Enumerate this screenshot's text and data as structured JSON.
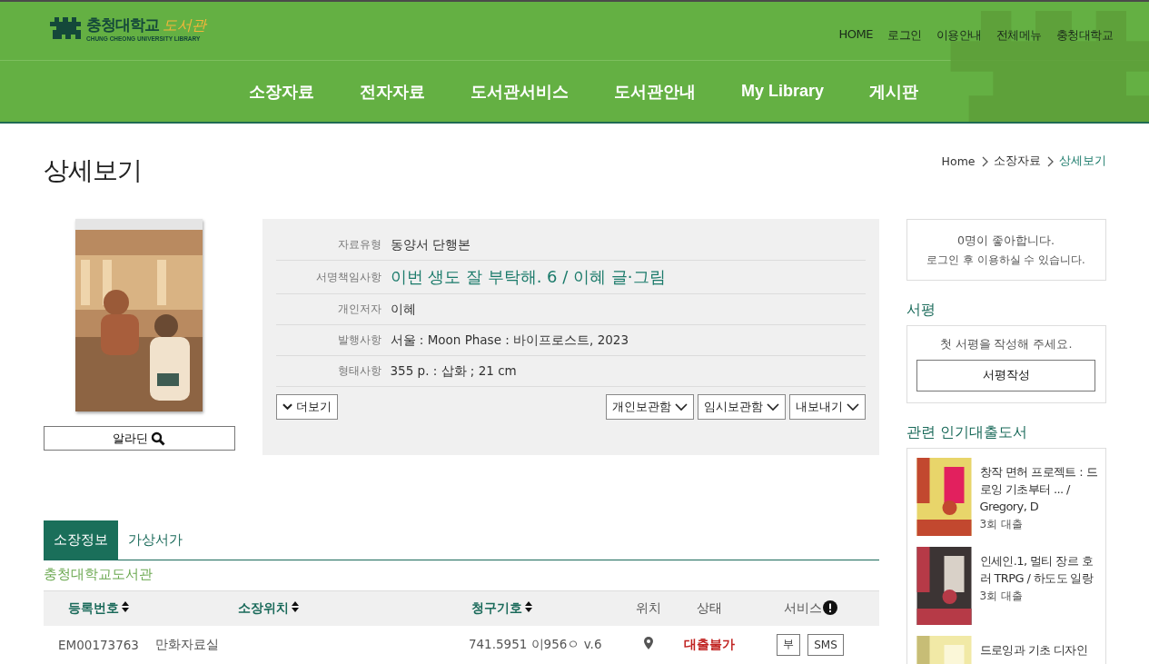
{
  "header": {
    "logo": {
      "name": "충청대학교",
      "library": "도서관",
      "subtitle": "CHUNG CHEONG UNIVERSITY LIBRARY"
    },
    "util_links": [
      "HOME",
      "로그인",
      "이용안내",
      "전체메뉴",
      "충청대학교"
    ],
    "nav": [
      "소장자료",
      "전자자료",
      "도서관서비스",
      "도서관안내",
      "My Library",
      "게시판"
    ]
  },
  "page_title": "상세보기",
  "breadcrumb": [
    {
      "label": "Home",
      "selected": false
    },
    {
      "label": "소장자료",
      "selected": false
    },
    {
      "label": "상세보기",
      "selected": true
    }
  ],
  "cover": {
    "link_label": "알라딘"
  },
  "details": [
    {
      "label": "자료유형",
      "value": "동양서 단행본",
      "kind": "plain"
    },
    {
      "label": "서명책임사항",
      "value": "이번 생도 잘 부탁해. 6 / 이혜 글·그림",
      "kind": "title"
    },
    {
      "label": "개인저자",
      "value": "이혜",
      "kind": "plain"
    },
    {
      "label": "발행사항",
      "value": "서울 : Moon Phase : 바이프로스트, 2023",
      "kind": "plain"
    },
    {
      "label": "형태사항",
      "value": "355 p. : 삽화 ; 21 cm",
      "kind": "plain"
    }
  ],
  "more_button": "더보기",
  "action_buttons": [
    "개인보관함",
    "임시보관함",
    "내보내기"
  ],
  "likes": {
    "count_line": "0명이 좋아합니다.",
    "note": "로그인 후 이용하실 수 있습니다."
  },
  "review": {
    "heading": "서평",
    "prompt": "첫 서평을 작성해 주세요.",
    "button": "서평작성"
  },
  "popular": {
    "heading": "관련 인기대출도서",
    "items": [
      {
        "title": "창작 면허 프로젝트 : 드로잉 기초부터 ... / Gregory, D",
        "loans": "3회 대출"
      },
      {
        "title": "인세인.1, 멀티 장르 호러 TRPG / 하도도 일랑",
        "loans": "3회 대출"
      },
      {
        "title": "드로잉과 기초 디자인"
      }
    ]
  },
  "tabs": [
    {
      "label": "소장정보",
      "selected": true
    },
    {
      "label": "가상서가",
      "selected": false
    }
  ],
  "library_name": "충청대학교도서관",
  "holdings": {
    "columns": [
      {
        "label": "등록번호",
        "sortable": true
      },
      {
        "label": "소장위치",
        "sortable": true
      },
      {
        "label": "청구기호",
        "sortable": true
      },
      {
        "label": "위치",
        "sortable": false
      },
      {
        "label": "상태",
        "sortable": false
      },
      {
        "label": "서비스",
        "sortable": false,
        "info": true
      }
    ],
    "rows": [
      {
        "reg_no": "EM00173763",
        "location": "만화자료실",
        "call_no": "741.5951 이956ㅇ v.6",
        "status": "대출불가",
        "available": false,
        "services": [
          "부",
          "SMS"
        ]
      }
    ]
  }
}
